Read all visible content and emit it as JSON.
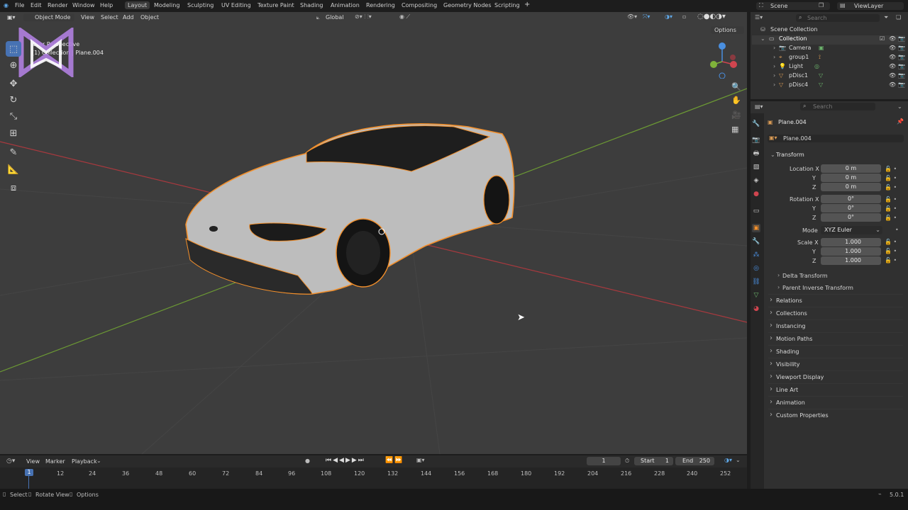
{
  "menu": {
    "file": "File",
    "edit": "Edit",
    "render": "Render",
    "window": "Window",
    "help": "Help"
  },
  "workspaces": [
    "Layout",
    "Modeling",
    "Sculpting",
    "UV Editing",
    "Texture Paint",
    "Shading",
    "Animation",
    "Rendering",
    "Compositing",
    "Geometry Nodes",
    "Scripting"
  ],
  "workspace_add": "+",
  "scene": {
    "name": "Scene",
    "view_layer": "ViewLayer"
  },
  "viewport_header": {
    "mode": "Object Mode",
    "view": "View",
    "select": "Select",
    "add": "Add",
    "object": "Object",
    "orientation": "Global",
    "options": "Options"
  },
  "overlay_text": {
    "line1": "User Perspective",
    "line2": "(1) Collection | Plane.004"
  },
  "outliner": {
    "search_placeholder": "Search",
    "root": "Scene Collection",
    "collection": "Collection",
    "items": [
      "Camera",
      "group1",
      "Light",
      "pDisc1",
      "pDisc4"
    ]
  },
  "properties": {
    "search_placeholder": "Search",
    "object_name": "Plane.004",
    "data_name": "Plane.004",
    "transform": "Transform",
    "location_label": "Location X",
    "y": "Y",
    "z": "Z",
    "location": [
      "0 m",
      "0 m",
      "0 m"
    ],
    "rotation_label": "Rotation X",
    "rotation": [
      "0°",
      "0°",
      "0°"
    ],
    "mode_label": "Mode",
    "mode_value": "XYZ Euler",
    "scale_label": "Scale X",
    "scale": [
      "1.000",
      "1.000",
      "1.000"
    ],
    "delta": "Delta Transform",
    "parent_inverse": "Parent Inverse Transform",
    "sections": [
      "Relations",
      "Collections",
      "Instancing",
      "Motion Paths",
      "Shading",
      "Visibility",
      "Viewport Display",
      "Line Art",
      "Animation",
      "Custom Properties"
    ]
  },
  "timeline": {
    "view": "View",
    "marker": "Marker",
    "playback": "Playback",
    "current_frame": "1",
    "start_label": "Start",
    "start": "1",
    "end_label": "End",
    "end": "250",
    "ticks": [
      "1",
      "12",
      "24",
      "36",
      "48",
      "60",
      "72",
      "84",
      "96",
      "108",
      "120",
      "132",
      "144",
      "156",
      "168",
      "180",
      "192",
      "204",
      "216",
      "228",
      "240",
      "252"
    ]
  },
  "status": {
    "select": "Select",
    "rotate": "Rotate View",
    "options": "Options",
    "version": "5.0.1"
  },
  "colors": {
    "selection": "#f28f2b",
    "axis_x": "#a8393e",
    "axis_y": "#6c9a34",
    "accent": "#4772b3"
  }
}
